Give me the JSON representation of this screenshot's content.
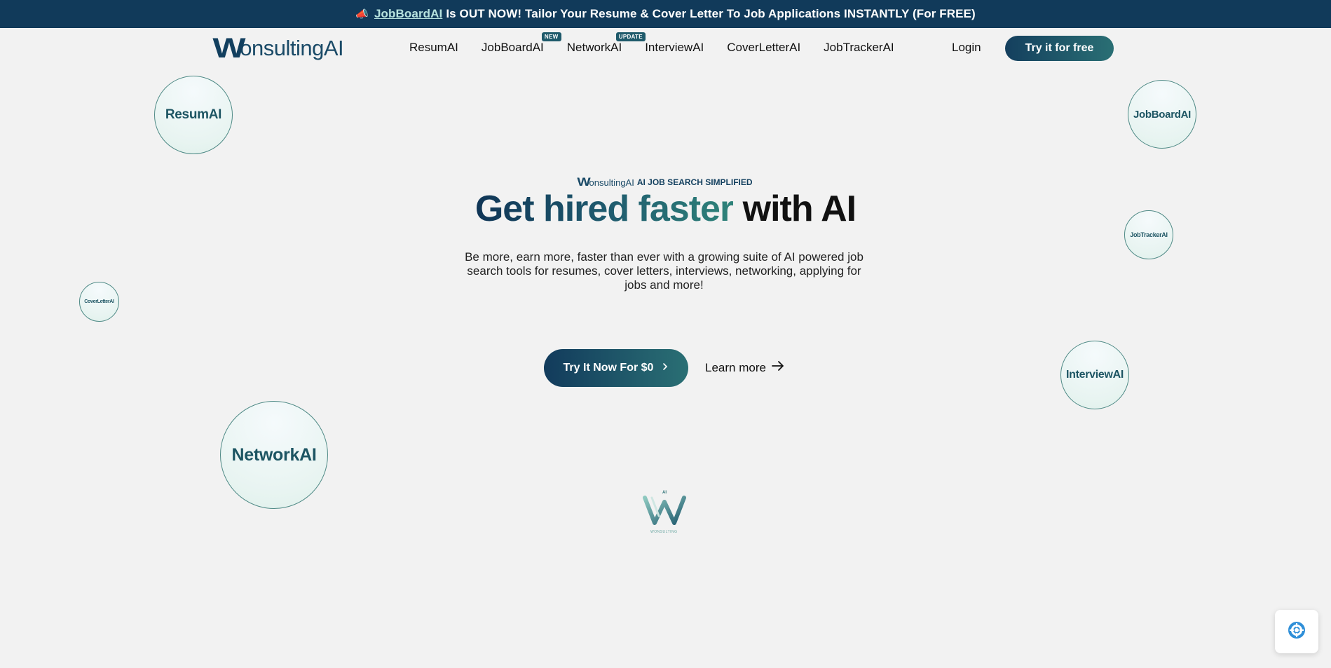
{
  "announcement": {
    "icon": "megaphone-icon",
    "link_text": "JobBoardAI",
    "text": "Is OUT NOW! Tailor Your Resume & Cover Letter To Job Applications INSTANTLY (For FREE)"
  },
  "nav": {
    "logo": {
      "initial": "W",
      "rest": "onsultingAI"
    },
    "items": [
      {
        "label": "ResumAI"
      },
      {
        "label": "JobBoardAI",
        "badge": "NEW"
      },
      {
        "label": "NetworkAI",
        "badge": "UPDATE"
      },
      {
        "label": "InterviewAI"
      },
      {
        "label": "CoverLetterAI"
      },
      {
        "label": "JobTrackerAI"
      }
    ],
    "login": "Login",
    "cta": "Try it for free"
  },
  "bubbles": {
    "resum": "ResumAI",
    "jobboard": "JobBoardAI",
    "jobtracker": "JobTrackerAI",
    "coverletter": "CoverLetterAI",
    "interview": "InterviewAI",
    "network": "NetworkAI"
  },
  "hero": {
    "tagline_logo_initial": "W",
    "tagline_logo_rest": "onsultingAI",
    "tagline": "AI JOB SEARCH SIMPLIFIED",
    "headline_gradient": "Get hired faster",
    "headline_dark": "with AI",
    "subtext": "Be more, earn more, faster than ever with a growing suite of AI powered job search tools for resumes, cover letters, interviews, networking, applying for jobs and more!",
    "cta": "Try It Now For $0",
    "learn_more": "Learn more"
  },
  "emblem": {
    "small_text": "AI",
    "caption": "WONSULTING"
  },
  "colors": {
    "brand_dark": "#113a5a",
    "brand_teal": "#2a6f74",
    "background": "#f2f2f2",
    "help_icon": "#2f8fd8"
  }
}
